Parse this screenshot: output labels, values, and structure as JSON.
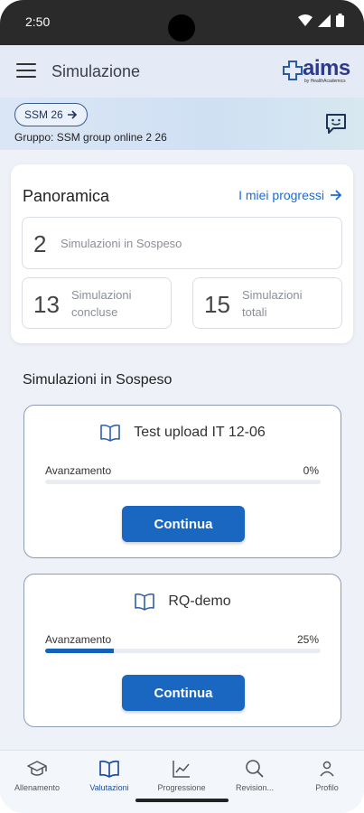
{
  "status_bar": {
    "time": "2:50"
  },
  "app_bar": {
    "title": "Simulazione",
    "logo_text": "aims",
    "logo_sub": "by HealthAcademics"
  },
  "group": {
    "chip_label": "SSM 26",
    "group_text": "Gruppo: SSM group online 2 26"
  },
  "overview": {
    "title": "Panoramica",
    "link": "I miei progressi",
    "pending": {
      "value": "2",
      "label": "Simulazioni in Sospeso"
    },
    "completed": {
      "value": "13",
      "label_line1": "Simulazioni",
      "label_line2": "concluse"
    },
    "total": {
      "value": "15",
      "label_line1": "Simulazioni",
      "label_line2": "totali"
    }
  },
  "pending_section": {
    "title": "Simulazioni in Sospeso",
    "items": [
      {
        "name": "Test upload IT 12-06",
        "progress_label": "Avanzamento",
        "progress_text": "0%",
        "progress_value": 0,
        "button": "Continua"
      },
      {
        "name": "RQ-demo",
        "progress_label": "Avanzamento",
        "progress_text": "25%",
        "progress_value": 25,
        "button": "Continua"
      }
    ]
  },
  "bottom_nav": {
    "items": [
      {
        "label": "Allenamento",
        "icon": "graduation-cap-icon"
      },
      {
        "label": "Valutazioni",
        "icon": "book-icon",
        "active": true
      },
      {
        "label": "Progressione",
        "icon": "chart-icon"
      },
      {
        "label": "Revision...",
        "icon": "search-icon"
      },
      {
        "label": "Profilo",
        "icon": "person-icon"
      }
    ]
  },
  "colors": {
    "accent": "#1a67c2",
    "progress_fill": "#1562b8",
    "active_nav": "#1f4f9c"
  }
}
